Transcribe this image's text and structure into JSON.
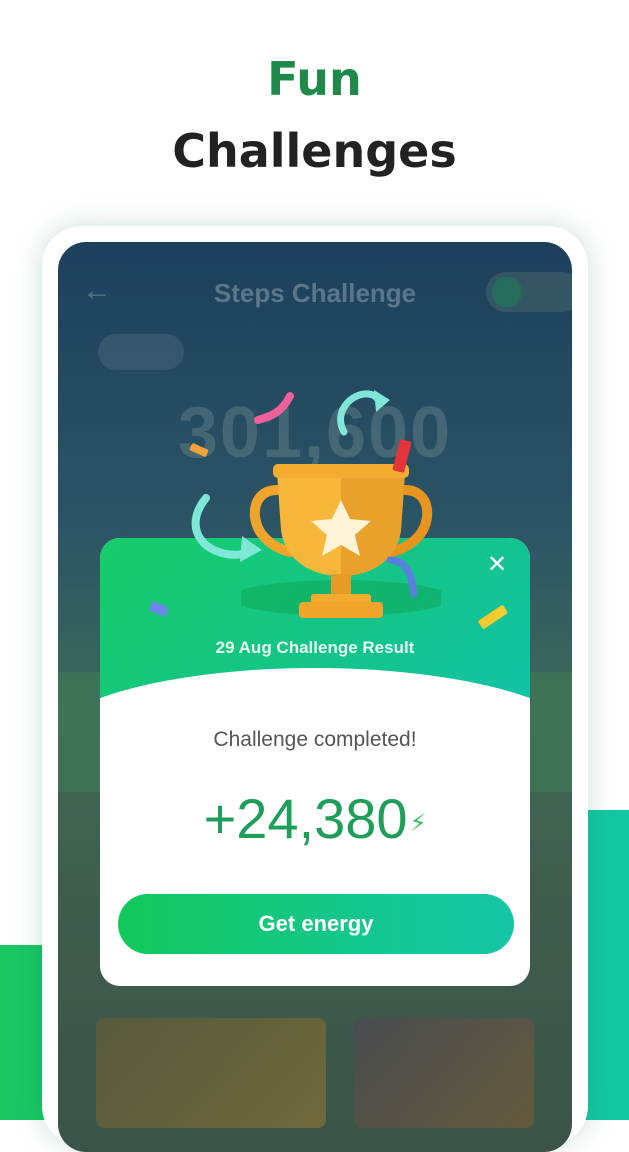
{
  "headline": {
    "accent": "Fun",
    "main": "Challenges"
  },
  "app": {
    "title": "Steps Challenge",
    "stat_value": "301,600"
  },
  "result_card": {
    "title": "29 Aug Challenge Result",
    "status": "Challenge completed!",
    "amount": "+24,380",
    "button_label": "Get energy"
  },
  "colors": {
    "accent_green": "#1e8a4a",
    "button_green": "#12c95c",
    "teal": "#15c6a8",
    "trophy_gold": "#f4a62a"
  },
  "icons": [
    "back-arrow-icon",
    "close-icon",
    "lightning-bolt-icon",
    "trophy-icon",
    "star-icon"
  ]
}
